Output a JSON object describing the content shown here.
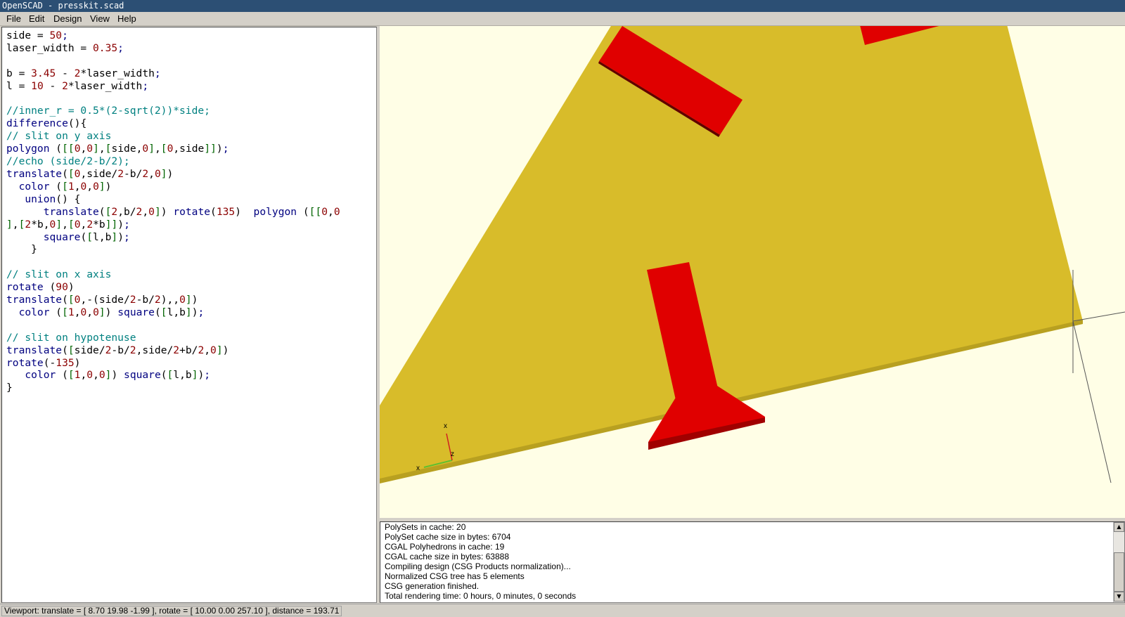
{
  "window": {
    "title": "OpenSCAD - presskit.scad"
  },
  "menu": {
    "file": "File",
    "edit": "Edit",
    "design": "Design",
    "view": "View",
    "help": "Help"
  },
  "editor": {
    "lines": [
      "side = 50;",
      "laser_width = 0.35;",
      "",
      "b = 3.45 - 2*laser_width;",
      "l = 10 - 2*laser_width;",
      "",
      "//inner_r = 0.5*(2-sqrt(2))*side;",
      "difference(){",
      "// slit on y axis",
      "polygon ([[0,0],[side,0],[0,side]]);",
      "//echo (side/2-b/2);",
      "translate([0,side/2-b/2,0])",
      "  color ([1,0,0])",
      "   union() {",
      "      translate([2,b/2,0]) rotate(135)  polygon ([[0,0",
      "],[2*b,0],[0,2*b]]);",
      "      square([l,b]);",
      "    }",
      "",
      "// slit on x axis",
      "rotate (90)",
      "translate([0,-(side/2-b/2),,0])",
      "  color ([1,0,0]) square([l,b]);",
      "",
      "// slit on hypotenuse",
      "translate([side/2-b/2,side/2+b/2,0])",
      "rotate(-135)",
      "   color ([1,0,0]) square([l,b]);",
      "}"
    ]
  },
  "viewport": {
    "axis_labels": {
      "x_near": "x",
      "x_far": "x",
      "z": "z"
    },
    "colors": {
      "background": "#fffee6",
      "plate": "#d8bc2a",
      "plate_edge": "#b8a020",
      "slit": "#e00000",
      "slit_dark": "#b00000"
    }
  },
  "console": {
    "lines": [
      "PolySets in cache: 20",
      "PolySet cache size in bytes: 6704",
      "CGAL Polyhedrons in cache: 19",
      "CGAL cache size in bytes: 63888",
      "Compiling design (CSG Products normalization)...",
      "Normalized CSG tree has 5 elements",
      "CSG generation finished.",
      "Total rendering time: 0 hours, 0 minutes, 0 seconds"
    ]
  },
  "status": {
    "text": "Viewport: translate = [ 8.70 19.98 -1.99 ], rotate = [ 10.00 0.00 257.10 ], distance = 193.71"
  }
}
